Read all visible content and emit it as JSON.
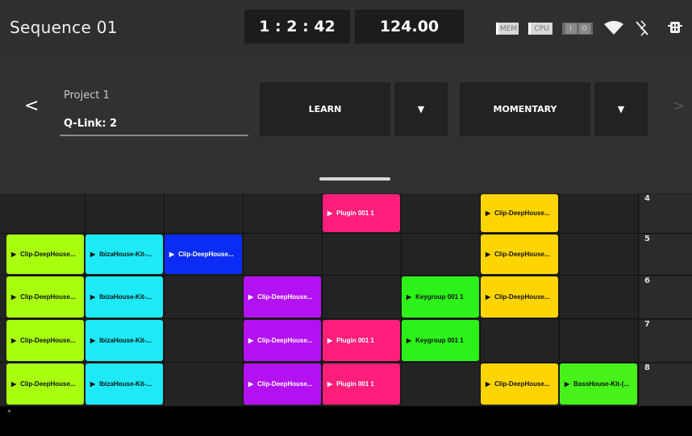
{
  "header": {
    "sequence_name": "Sequence 01",
    "position": "1 : 2 : 42",
    "tempo": "124.00",
    "mem_label": "MEM",
    "cpu_label": "CPU",
    "input_label": "I",
    "output_label": "O",
    "icons": [
      "wifi-icon",
      "bluetooth-off-icon",
      "usb-drive-icon"
    ]
  },
  "panel": {
    "back": "<",
    "forward": ">",
    "project": "Project 1",
    "qlink": "Q-Link: 2",
    "mode1": "LEARN",
    "mode2": "MOMENTARY",
    "caret": "▼"
  },
  "scenes": [
    "4",
    "5",
    "6",
    "7",
    "8"
  ],
  "clips": [
    {
      "row": 0,
      "col": 4,
      "label": "Plugin 001 1",
      "color": "#ff1f7a"
    },
    {
      "row": 0,
      "col": 6,
      "label": "Clip-DeepHouse...",
      "color": "#ffd500"
    },
    {
      "row": 1,
      "col": 0,
      "label": "Clip-DeepHouse...",
      "color": "#a8ff0f"
    },
    {
      "row": 1,
      "col": 1,
      "label": "IbizaHouse-Kit-...",
      "color": "#1eeaf7"
    },
    {
      "row": 1,
      "col": 2,
      "label": "Clip-DeepHouse...",
      "color": "#0a2cf5"
    },
    {
      "row": 1,
      "col": 6,
      "label": "Clip-DeepHouse...",
      "color": "#ffd500"
    },
    {
      "row": 2,
      "col": 0,
      "label": "Clip-DeepHouse...",
      "color": "#a8ff0f"
    },
    {
      "row": 2,
      "col": 1,
      "label": "IbizaHouse-Kit-...",
      "color": "#1eeaf7"
    },
    {
      "row": 2,
      "col": 3,
      "label": "Clip-DeepHouse...",
      "color": "#b211f2"
    },
    {
      "row": 2,
      "col": 5,
      "label": "Keygroup 001 1",
      "color": "#2df21a"
    },
    {
      "row": 2,
      "col": 6,
      "label": "Clip-DeepHouse...",
      "color": "#ffd500"
    },
    {
      "row": 3,
      "col": 0,
      "label": "Clip-DeepHouse...",
      "color": "#a8ff0f"
    },
    {
      "row": 3,
      "col": 1,
      "label": "IbizaHouse-Kit-...",
      "color": "#1eeaf7"
    },
    {
      "row": 3,
      "col": 3,
      "label": "Clip-DeepHouse...",
      "color": "#b211f2"
    },
    {
      "row": 3,
      "col": 4,
      "label": "Plugin 001 1",
      "color": "#ff1f7a"
    },
    {
      "row": 3,
      "col": 5,
      "label": "Keygroup 001 1",
      "color": "#2df21a"
    },
    {
      "row": 4,
      "col": 0,
      "label": "Clip-DeepHouse...",
      "color": "#a8ff0f"
    },
    {
      "row": 4,
      "col": 1,
      "label": "IbizaHouse-Kit-...",
      "color": "#1eeaf7"
    },
    {
      "row": 4,
      "col": 3,
      "label": "Clip-DeepHouse...",
      "color": "#b211f2"
    },
    {
      "row": 4,
      "col": 4,
      "label": "Plugin 001 1",
      "color": "#ff1f7a"
    },
    {
      "row": 4,
      "col": 6,
      "label": "Clip-DeepHouse...",
      "color": "#ffd500"
    },
    {
      "row": 4,
      "col": 7,
      "label": "BassHouse-Kit-(...",
      "color": "#46f21a"
    }
  ]
}
